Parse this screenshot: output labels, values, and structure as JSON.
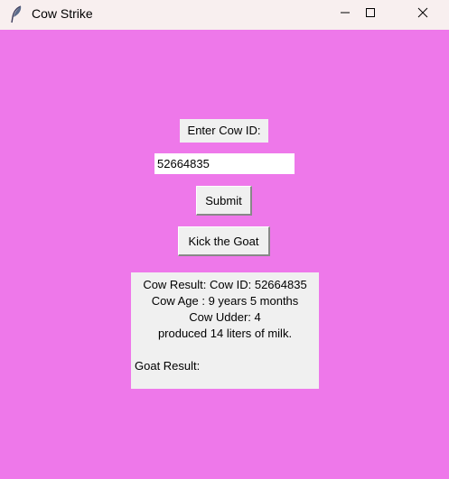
{
  "window": {
    "title": "Cow Strike",
    "icon": "feather-icon",
    "controls": {
      "minimize": "minimize-icon",
      "maximize": "maximize-icon",
      "close": "close-icon"
    }
  },
  "colors": {
    "background": "#ee78ea",
    "widget": "#f0f0f0",
    "titlebar": "#f8efef"
  },
  "form": {
    "prompt_label": "Enter Cow ID:",
    "cow_id_value": "52664835",
    "submit_label": "Submit",
    "kick_goat_label": "Kick the Goat"
  },
  "result": {
    "cow_line": "Cow Result: Cow ID: 52664835",
    "age_line": "Cow Age : 9 years 5 months",
    "udder_line": "Cow Udder: 4",
    "milk_line": "produced 14 liters of milk.",
    "goat_line": "Goat Result:"
  }
}
